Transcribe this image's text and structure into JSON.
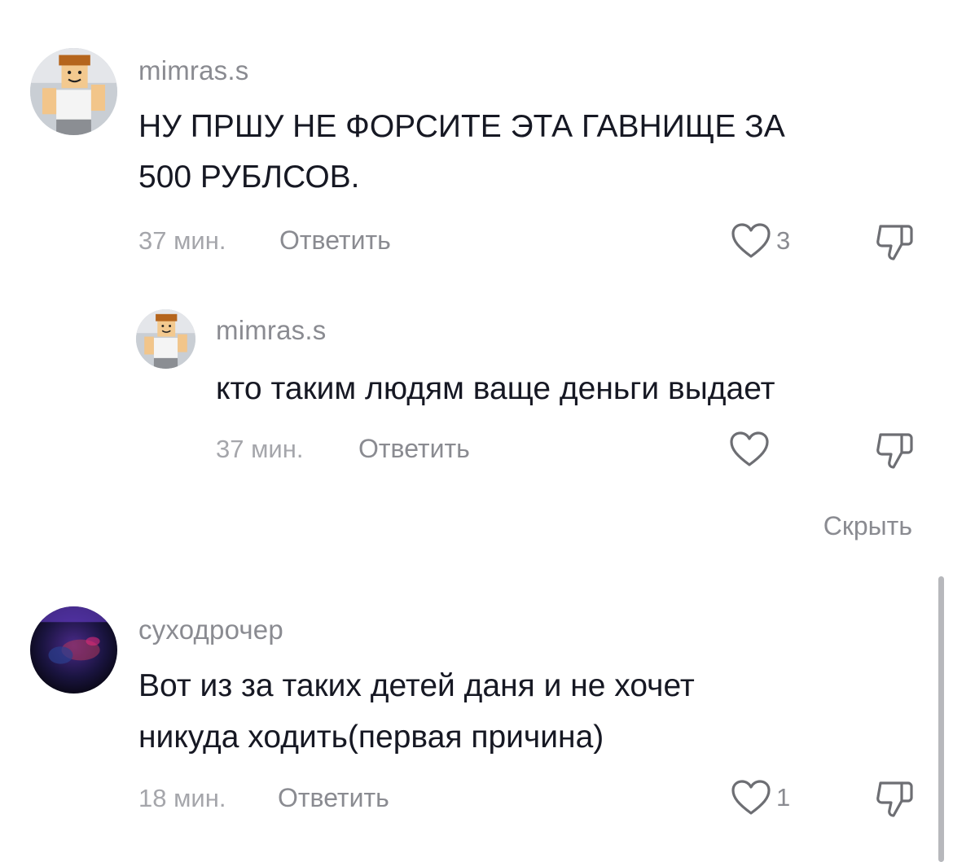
{
  "comments": [
    {
      "username": "mimras.s",
      "text_line1": "НУ ПРШУ НЕ ФОРСИТЕ ЭТА ГАВНИЩЕ ЗА",
      "text_line2": "500 РУБЛСОВ.",
      "time": "37 мин.",
      "reply_label": "Ответить",
      "likes": "3",
      "avatar_icon": "roblox-avatar-icon"
    },
    {
      "username": "mimras.s",
      "text_line1": "кто таким людям ваще деньги выдает",
      "time": "37 мин.",
      "reply_label": "Ответить",
      "likes": "",
      "avatar_icon": "roblox-avatar-icon"
    },
    {
      "username": "суходрочер",
      "text_line1": "Вот из за таких детей даня и не хочет",
      "text_line2": "никуда ходить(первая причина)",
      "time": "18 мин.",
      "reply_label": "Ответить",
      "likes": "1",
      "avatar_icon": "dark-photo-avatar-icon"
    }
  ],
  "hide_label": "Скрыть",
  "icons": {
    "like": "heart-outline-icon",
    "dislike": "thumbs-down-icon"
  },
  "colors": {
    "text": "#161823",
    "secondary": "#8a8b91",
    "time": "#a5a6ab"
  }
}
